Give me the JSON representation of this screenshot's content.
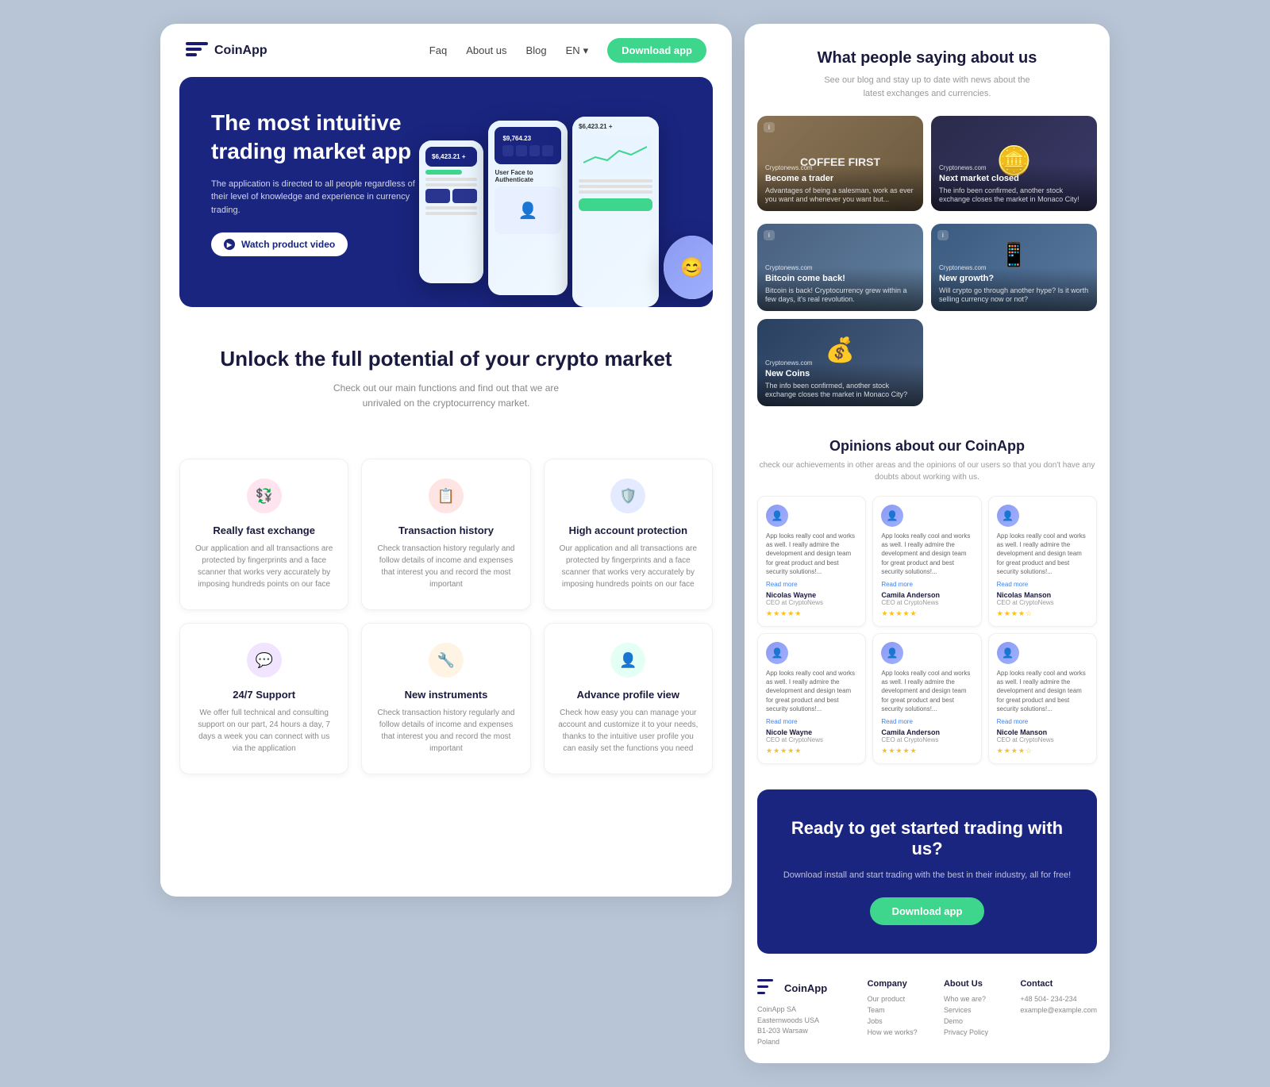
{
  "navbar": {
    "logo": "CoinApp",
    "links": [
      "Faq",
      "About us",
      "Blog"
    ],
    "lang": "EN",
    "download_btn": "Download app"
  },
  "hero": {
    "title": "The most intuitive trading market app",
    "subtitle": "The application is directed to all people regardless of their level of knowledge and experience in currency trading.",
    "watch_btn": "Watch product video"
  },
  "unlock": {
    "title": "Unlock the full potential of your crypto market",
    "subtitle": "Check out our main functions and find out that we are unrivaled on the cryptocurrency market."
  },
  "features": [
    {
      "icon": "💱",
      "icon_class": "pink",
      "title": "Really fast exchange",
      "desc": "Our application and all transactions are protected by fingerprints and a face scanner that works very accurately by imposing hundreds points on our face"
    },
    {
      "icon": "📋",
      "icon_class": "red",
      "title": "Transaction history",
      "desc": "Check transaction history regularly and follow details of income and expenses that interest you and record the most important"
    },
    {
      "icon": "🛡️",
      "icon_class": "blue",
      "title": "High account protection",
      "desc": "Our application and all transactions are protected by fingerprints and a face scanner that works very accurately by imposing hundreds points on our face"
    },
    {
      "icon": "💬",
      "icon_class": "purple",
      "title": "24/7 Support",
      "desc": "We offer full technical and consulting support on our part, 24 hours a day, 7 days a week you can connect with us via the application"
    },
    {
      "icon": "🔧",
      "icon_class": "orange",
      "title": "New instruments",
      "desc": "Check transaction history regularly and follow details of income and expenses that interest you and record the most important"
    },
    {
      "icon": "👤",
      "icon_class": "green",
      "title": "Advance profile view",
      "desc": "Check how easy you can manage your account and customize it to your needs, thanks to the intuitive user profile you can easily set the functions you need"
    }
  ],
  "right": {
    "section1": {
      "title": "What people saying about us",
      "subtitle": "See our blog and stay up to date with news about the latest exchanges and currencies."
    },
    "videos": [
      {
        "id": "trader",
        "bg_class": "bg-coffee",
        "source": "Cryptonews.com",
        "title": "Become a trader",
        "desc": "Advantages of being a salesman, work as ever you want and whenever you want but...",
        "badge": "i"
      },
      {
        "id": "market",
        "bg_class": "bg-coin",
        "source": "Cryptonews.com",
        "title": "Next market closed",
        "desc": "The info been confirmed, another stock exchange closes the market in Monaco City!",
        "badge": ""
      },
      {
        "id": "bitcoin",
        "bg_class": "bg-bitcoin",
        "source": "Cryptonews.com",
        "title": "Bitcoin come back!",
        "desc": "Bitcoin is back! Cryptocurrency grew within a few days, it's real revolution.",
        "badge": "i"
      },
      {
        "id": "growth",
        "bg_class": "bg-growth",
        "source": "Cryptonews.com",
        "title": "New growth?",
        "desc": "Will crypto go through another hype? Is it worth selling currency now or not?",
        "badge": "i"
      },
      {
        "id": "newcoins",
        "bg_class": "bg-newcoins",
        "source": "Cryptonews.com",
        "title": "New Coins",
        "desc": "The info been confirmed, another stock exchange closes the market in Monaco City?",
        "badge": ""
      }
    ],
    "opinions": {
      "title": "Opinions about our CoinApp",
      "subtitle": "check our achievements in other areas and the opinions of our users so that you don't have any doubts about working with us.",
      "reviews": [
        {
          "avatar": "👤",
          "text": "App looks really cool and works as well. I really admire the development and design team for great product and best security solutions!...",
          "read_more": "Read more",
          "name": "Nicolas Wayne",
          "role": "CEO at CryptoNews",
          "stars": "★★★★★"
        },
        {
          "avatar": "👤",
          "text": "App looks really cool and works as well. I really admire the development and design team for great product and best security solutions!...",
          "read_more": "Read more",
          "name": "Camila Anderson",
          "role": "CEO at CryptoNews",
          "stars": "★★★★★"
        },
        {
          "avatar": "👤",
          "text": "App looks really cool and works as well. I really admire the development and design team for great product and best security solutions!...",
          "read_more": "Read more",
          "name": "Nicolas Manson",
          "role": "CEO at CryptoNews",
          "stars": "★★★★☆"
        },
        {
          "avatar": "👤",
          "text": "App looks really cool and works as well. I really admire the development and design team for great product and best security solutions!...",
          "read_more": "Read more",
          "name": "Nicole Wayne",
          "role": "CEO at CryptoNews",
          "stars": "★★★★★"
        },
        {
          "avatar": "👤",
          "text": "App looks really cool and works as well. I really admire the development and design team for great product and best security solutions!...",
          "read_more": "Read more",
          "name": "Camila Anderson",
          "role": "CEO at CryptoNews",
          "stars": "★★★★★"
        },
        {
          "avatar": "👤",
          "text": "App looks really cool and works as well. I really admire the development and design team for great product and best security solutions!...",
          "read_more": "Read more",
          "name": "Nicole Manson",
          "role": "CEO at CryptoNews",
          "stars": "★★★★☆"
        }
      ]
    },
    "cta": {
      "title": "Ready to get started trading with us?",
      "subtitle": "Download install and start trading with the best in their industry, all for free!",
      "btn": "Download app"
    },
    "footer": {
      "brand": "CoinApp",
      "address": "CoinApp SA\nEasternwoods USA\nB1-203 Warsaw\nPoland",
      "company": {
        "title": "Company",
        "links": [
          "Our product",
          "Team",
          "Jobs",
          "How we works?"
        ]
      },
      "about": {
        "title": "About Us",
        "links": [
          "Who we are?",
          "Services",
          "Demo",
          "Privacy Policy"
        ]
      },
      "contact": {
        "title": "Contact",
        "phone": "+48 504- 234-234",
        "email": "example@example.com"
      }
    }
  }
}
